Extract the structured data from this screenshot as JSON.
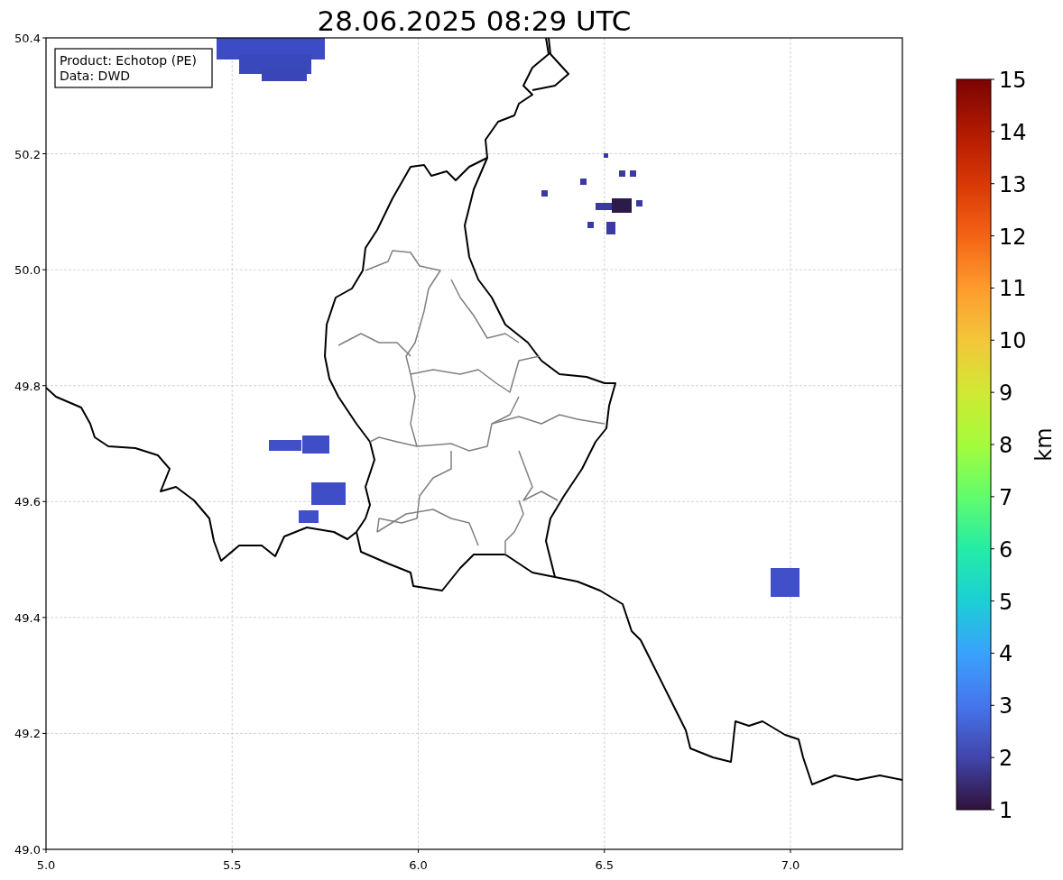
{
  "title": "28.06.2025 08:29 UTC",
  "map": {
    "x_ticks": [
      "5.0",
      "5.5",
      "6.0",
      "6.5",
      "7.0"
    ],
    "y_ticks": [
      "50.4",
      "50.2",
      "50.0",
      "49.8",
      "49.6",
      "49.4",
      "49.2",
      "49.0"
    ],
    "info_box": [
      "Product: Echotop (PE)",
      "Data: DWD"
    ]
  },
  "colorbar": {
    "ticks": [
      "15",
      "14",
      "13",
      "12",
      "11",
      "10",
      "9",
      "8",
      "7",
      "6",
      "5",
      "4",
      "3",
      "2",
      "1"
    ],
    "label": "km"
  }
}
